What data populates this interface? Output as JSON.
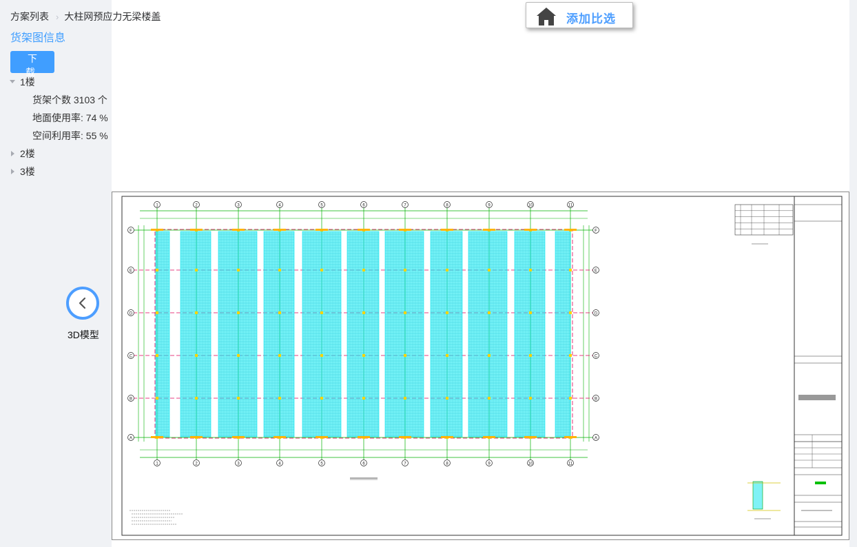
{
  "breadcrumb": {
    "root": "方案列表",
    "current": "大柱网预应力无梁楼盖"
  },
  "panel": {
    "title": "货架图信息",
    "download_label": "下 载"
  },
  "floors": [
    {
      "label": "1楼",
      "expanded": true,
      "stats": [
        {
          "text": "货架个数 3103 个"
        },
        {
          "text": "地面使用率:   74 %"
        },
        {
          "text": "空间利用率:   55 %"
        }
      ]
    },
    {
      "label": "2楼",
      "expanded": false
    },
    {
      "label": "3楼",
      "expanded": false
    }
  ],
  "model_nav": {
    "label": "3D模型",
    "icon": "chevron-left-icon"
  },
  "compare": {
    "label": "添加比选",
    "icon": "home-icon"
  },
  "drawing": {
    "column_labels": [
      "1",
      "2",
      "3",
      "4",
      "5",
      "6",
      "7",
      "8",
      "9",
      "10",
      "11"
    ],
    "row_labels": [
      "F",
      "E",
      "D",
      "C",
      "B",
      "A"
    ],
    "rack_color": "#00e5ee",
    "grid_color": "#00b000",
    "axis_color": "#e0005a"
  },
  "colors": {
    "accent": "#409eff",
    "panel_bg": "#f0f2f5"
  }
}
